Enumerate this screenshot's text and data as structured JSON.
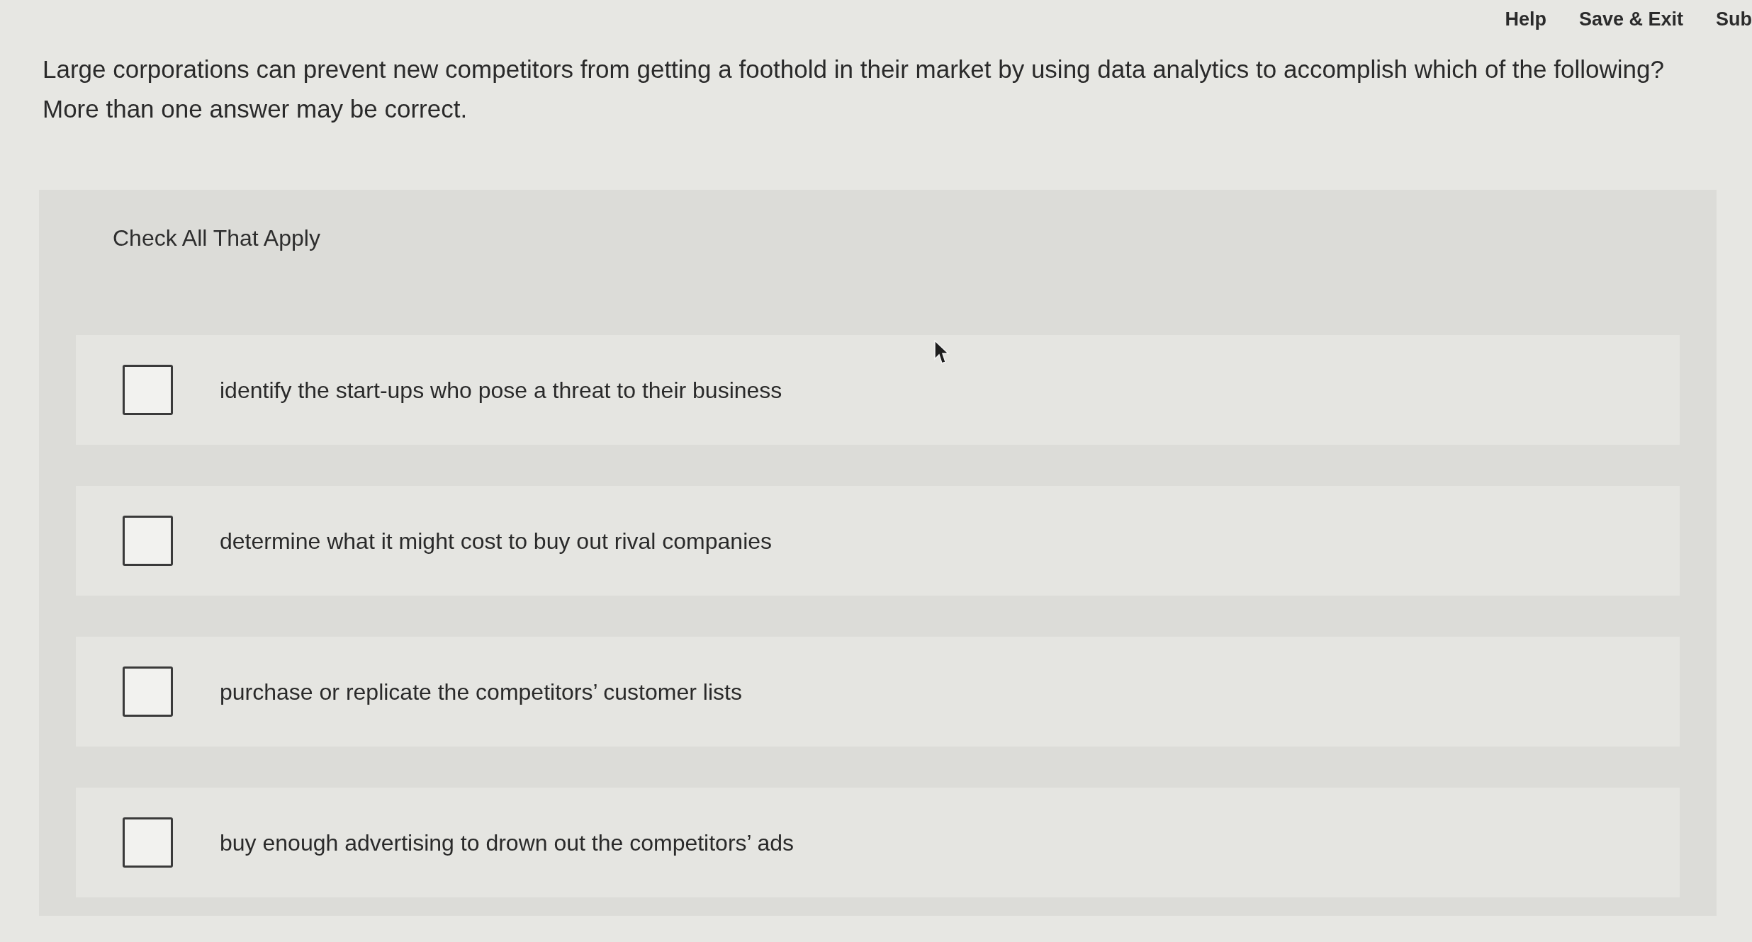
{
  "header": {
    "links": [
      "Help",
      "Save & Exit",
      "Sub"
    ]
  },
  "question": {
    "prompt": "Large corporations can prevent new competitors from getting a foothold in their market by using data analytics to accomplish which of the following?",
    "note": "More than one answer may be correct."
  },
  "answer_panel": {
    "instruction": "Check All That Apply",
    "options": [
      {
        "label": "identify the start-ups who pose a threat to their business",
        "checked": false
      },
      {
        "label": "determine what it might cost to buy out rival companies",
        "checked": false
      },
      {
        "label": "purchase or replicate the competitors’ customer lists",
        "checked": false
      },
      {
        "label": "buy enough advertising to drown out the competitors’ ads",
        "checked": false
      }
    ]
  }
}
